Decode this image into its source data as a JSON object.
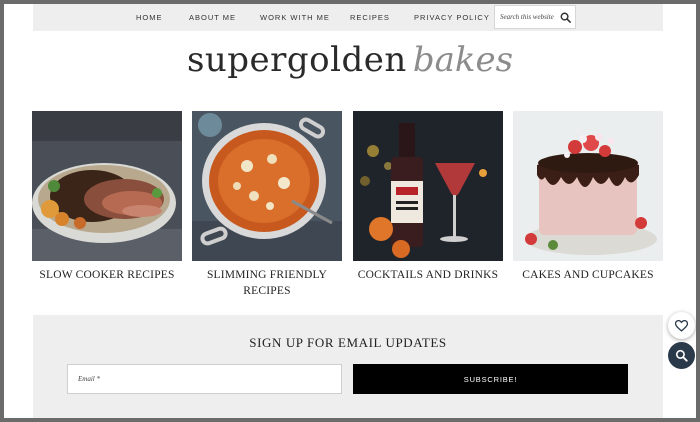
{
  "nav": {
    "items": [
      {
        "label": "HOME"
      },
      {
        "label": "ABOUT ME"
      },
      {
        "label": "WORK WITH ME"
      },
      {
        "label": "RECIPES"
      },
      {
        "label": "PRIVACY POLICY"
      }
    ],
    "search_placeholder": "Search this website"
  },
  "logo": {
    "main": "supergolden",
    "accent": "bakes"
  },
  "categories": [
    {
      "title": "SLOW COOKER RECIPES",
      "image": "roast-meat-photo"
    },
    {
      "title": "SLIMMING FRIENDLY RECIPES",
      "image": "casserole-dish-photo"
    },
    {
      "title": "COCKTAILS AND DRINKS",
      "image": "cocktail-bottle-photo"
    },
    {
      "title": "CAKES AND CUPCAKES",
      "image": "drip-cake-photo"
    }
  ],
  "signup": {
    "title": "SIGN UP FOR EMAIL UPDATES",
    "email_placeholder": "Email *",
    "button_label": "SUBSCRIBE!"
  },
  "icons": {
    "search": "search-icon",
    "favorite": "heart-icon",
    "zoom": "magnifier-icon"
  },
  "colors": {
    "nav_bg": "#eeeeee",
    "accent_dark": "#2b3a4a",
    "button_bg": "#000000",
    "logo_accent": "#8c8c8c"
  }
}
